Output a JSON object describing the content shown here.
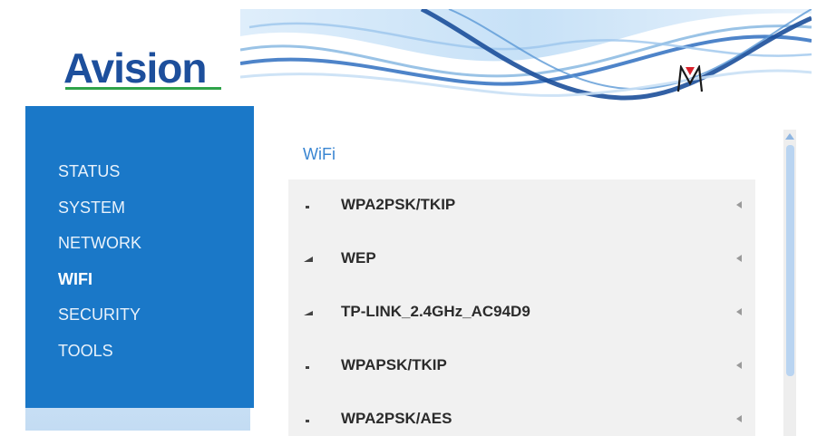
{
  "header": {
    "logo_text": "Avision",
    "brand_mark": "M"
  },
  "colors": {
    "sidebar": "#1a78c8",
    "accent": "#3a86d2",
    "logo": "#1d4f9c",
    "logo_underline": "#2fa34a",
    "list_background": "#f1f1f1"
  },
  "sidebar": {
    "items": [
      {
        "label": "STATUS",
        "active": false
      },
      {
        "label": "SYSTEM",
        "active": false
      },
      {
        "label": "NETWORK",
        "active": false
      },
      {
        "label": "WIFI",
        "active": true
      },
      {
        "label": "SECURITY",
        "active": false
      },
      {
        "label": "TOOLS",
        "active": false
      }
    ]
  },
  "content": {
    "title": "WiFi",
    "networks": [
      {
        "name": "WPA2PSK/TKIP",
        "signal_icon": "signal-weak-icon",
        "arrow_icon": "chevron-icon"
      },
      {
        "name": "WEP",
        "signal_icon": "signal-medium-icon",
        "arrow_icon": "chevron-icon"
      },
      {
        "name": "TP-LINK_2.4GHz_AC94D9",
        "signal_icon": "signal-medium-icon",
        "arrow_icon": "chevron-icon"
      },
      {
        "name": "WPAPSK/TKIP",
        "signal_icon": "signal-weak-icon",
        "arrow_icon": "chevron-icon"
      },
      {
        "name": "WPA2PSK/AES",
        "signal_icon": "signal-weak-icon",
        "arrow_icon": "chevron-icon"
      }
    ]
  }
}
